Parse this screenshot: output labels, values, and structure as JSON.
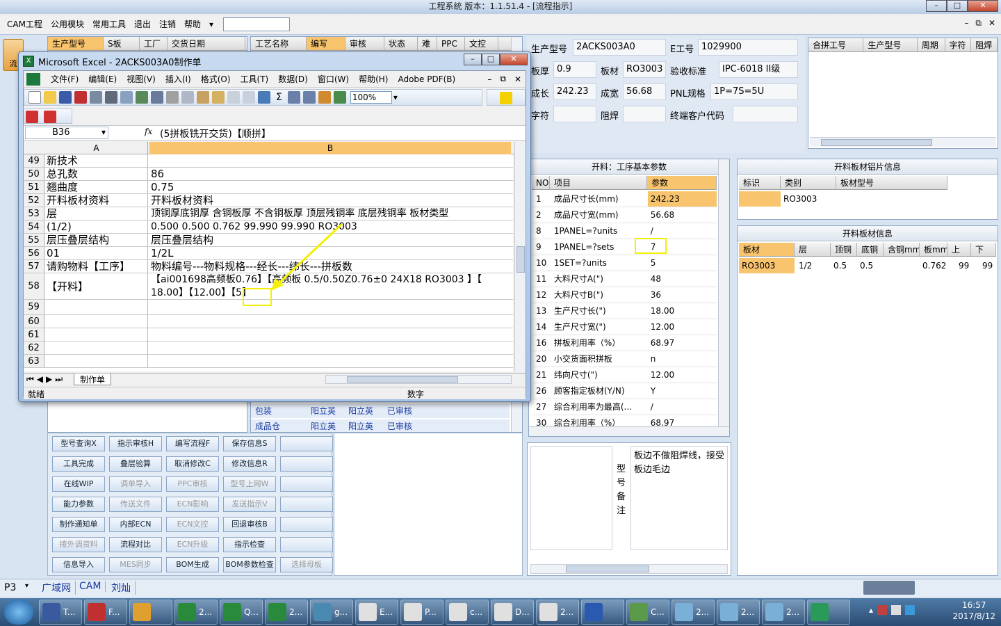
{
  "window": {
    "title": "工程系统    版本：1.1.51.4 - [流程指示]"
  },
  "menu": [
    "CAM工程",
    "公用模块",
    "常用工具",
    "退出",
    "注销",
    "帮助"
  ],
  "left_grid": {
    "headers": [
      "生产型号",
      "S板",
      "工厂",
      "交货日期"
    ]
  },
  "flow_grid": {
    "headers": [
      "工艺名称",
      "编写",
      "审核",
      "状态",
      "难",
      "PPC",
      "文控"
    ],
    "rows": [
      [
        "包装",
        "阳立英",
        "阳立英",
        "已审核"
      ],
      [
        "成品仓",
        "阳立英",
        "阳立英",
        "已审核"
      ]
    ]
  },
  "info": {
    "model_label": "生产型号",
    "model": "2ACKS003A0",
    "eno_label": "E工号",
    "eno": "1029900",
    "thick_label": "板厚",
    "thick": "0.9",
    "material_label": "板材",
    "material": "RO3003",
    "std_label": "验收标准",
    "std": "IPC-6018 II级",
    "len_label": "成长",
    "len": "242.23",
    "wid_label": "成宽",
    "wid": "56.68",
    "pnl_label": "PNL规格",
    "pnl": "1P=7S=5U",
    "char_label": "字符",
    "mask_label": "阻焊",
    "cust_label": "终端客户代码"
  },
  "merge_grid": {
    "headers": [
      "合拼工号",
      "生产型号",
      "周期",
      "字符",
      "阻焊"
    ]
  },
  "params": {
    "title": "开料：工序基本参数",
    "headers": [
      "NO",
      "项目",
      "参数"
    ],
    "rows": [
      [
        "1",
        "成品尺寸长(mm)",
        "242.23"
      ],
      [
        "2",
        "成品尺寸宽(mm)",
        "56.68"
      ],
      [
        "8",
        "1PANEL=?units",
        "/"
      ],
      [
        "9",
        "1PANEL=?sets",
        "7"
      ],
      [
        "10",
        "1SET=?units",
        "5"
      ],
      [
        "11",
        "大料尺寸A(\")",
        "48"
      ],
      [
        "12",
        "大料尺寸B(\")",
        "36"
      ],
      [
        "13",
        "生产尺寸长(\")",
        "18.00"
      ],
      [
        "14",
        "生产尺寸宽(\")",
        "12.00"
      ],
      [
        "16",
        "拼板利用率（%）",
        "68.97"
      ],
      [
        "20",
        "小交货面积拼板",
        "n"
      ],
      [
        "21",
        "纬向尺寸(\")",
        "12.00"
      ],
      [
        "26",
        "顾客指定板材(Y/N)",
        "Y"
      ],
      [
        "27",
        "综合利用率为最高(...",
        "/"
      ],
      [
        "30",
        "综合利用率（%）",
        "68.97"
      ]
    ]
  },
  "slice_info": {
    "title": "开料板材铝片信息",
    "headers": [
      "标识",
      "类别",
      "板材型号"
    ],
    "row": [
      "",
      "RO3003",
      ""
    ]
  },
  "material_info": {
    "title": "开料板材信息",
    "headers": [
      "板材",
      "层",
      "顶铜",
      "底铜",
      "含铜mm",
      "板mm",
      "上",
      "下"
    ],
    "row": [
      "RO3003",
      "1/2",
      "0.5",
      "0.5",
      "",
      "0.762",
      "99",
      "99"
    ]
  },
  "remark": {
    "label": "型号备注",
    "text": "板边不做阻焊线，接受板边毛边"
  },
  "buttons": [
    [
      "型号查询X",
      "指示审核H",
      "编写流程F",
      "保存信息S",
      ""
    ],
    [
      "工具完成",
      "叠层验算",
      "取消修改C",
      "修改信息R",
      ""
    ],
    [
      "在线WIP",
      "调单导入",
      "PPC审核",
      "型号上网W",
      ""
    ],
    [
      "能力参数",
      "传送文件",
      "ECN影响",
      "发送指示V",
      ""
    ],
    [
      "制作通知单",
      "内部ECN",
      "ECN文控",
      "回退审核B",
      ""
    ],
    [
      "接外调资料",
      "流程对比",
      "ECN升级",
      "指示检查",
      ""
    ],
    [
      "信息导入",
      "MES同步",
      "BOM生成",
      "BOM参数检查",
      "选择母板"
    ]
  ],
  "buttons_disabled": [
    [
      false,
      false,
      false,
      false,
      false
    ],
    [
      false,
      false,
      false,
      false,
      false
    ],
    [
      false,
      true,
      true,
      true,
      false
    ],
    [
      false,
      true,
      true,
      true,
      false
    ],
    [
      false,
      false,
      true,
      false,
      false
    ],
    [
      true,
      false,
      true,
      false,
      false
    ],
    [
      false,
      true,
      false,
      false,
      true
    ]
  ],
  "excel": {
    "title": "Microsoft Excel - 2ACKS003A0制作单",
    "menu": [
      "文件(F)",
      "编辑(E)",
      "视图(V)",
      "插入(I)",
      "格式(O)",
      "工具(T)",
      "数据(D)",
      "窗口(W)",
      "帮助(H)",
      "Adobe PDF(B)"
    ],
    "zoom": "100%",
    "cell_ref": "B36",
    "formula": "(5拼板铣开交货)【顺拼】",
    "col_a": "A",
    "col_b": "B",
    "rows": [
      [
        "49",
        "新技术",
        ""
      ],
      [
        "50",
        "总孔数",
        "86"
      ],
      [
        "51",
        "翘曲度",
        "0.75"
      ],
      [
        "52",
        "开料板材资料",
        "开料板材资料"
      ],
      [
        "53",
        "层",
        "顶铜厚底铜厚 含铜板厚 不含铜板厚 顶层残铜率 底层残铜率 板材类型"
      ],
      [
        "54",
        "(1/2)",
        "0.500  0.500        0.762       99.990      99.990       RO3003"
      ],
      [
        "55",
        "层压叠层结构",
        "层压叠层结构"
      ],
      [
        "56",
        "01",
        "1/2L"
      ],
      [
        "57",
        "请购物料【工序】",
        "物料编号---物料规格---经长---纬长---拼板数"
      ],
      [
        "58",
        "【开料】",
        "【ai001698高频板0.76】【高频板 0.5/0.50Z0.76±0 24X18  RO3003 】【"
      ],
      [
        "59",
        "",
        ""
      ],
      [
        "60",
        "",
        ""
      ],
      [
        "61",
        "",
        ""
      ],
      [
        "62",
        "",
        ""
      ],
      [
        "63",
        "",
        ""
      ]
    ],
    "row58_line2": "18.00】【12.00】【5】",
    "sheet_tab": "制作单",
    "status": "就绪",
    "status_num": "数字"
  },
  "statusbar": {
    "p": "P3",
    "items": [
      "广域网",
      "CAM",
      "刘灿"
    ]
  },
  "taskbar": {
    "items": [
      "T...",
      "F...",
      "",
      "2...",
      "Q...",
      "2...",
      "g...",
      "E...",
      "P...",
      "c...",
      "D...",
      "2...",
      "",
      "C...",
      "2...",
      "2...",
      "2...",
      ""
    ],
    "time": "16:57",
    "date": "2017/8/12"
  },
  "colors": {
    "highlight": "#f9c46e",
    "annot": "#f5f000"
  }
}
